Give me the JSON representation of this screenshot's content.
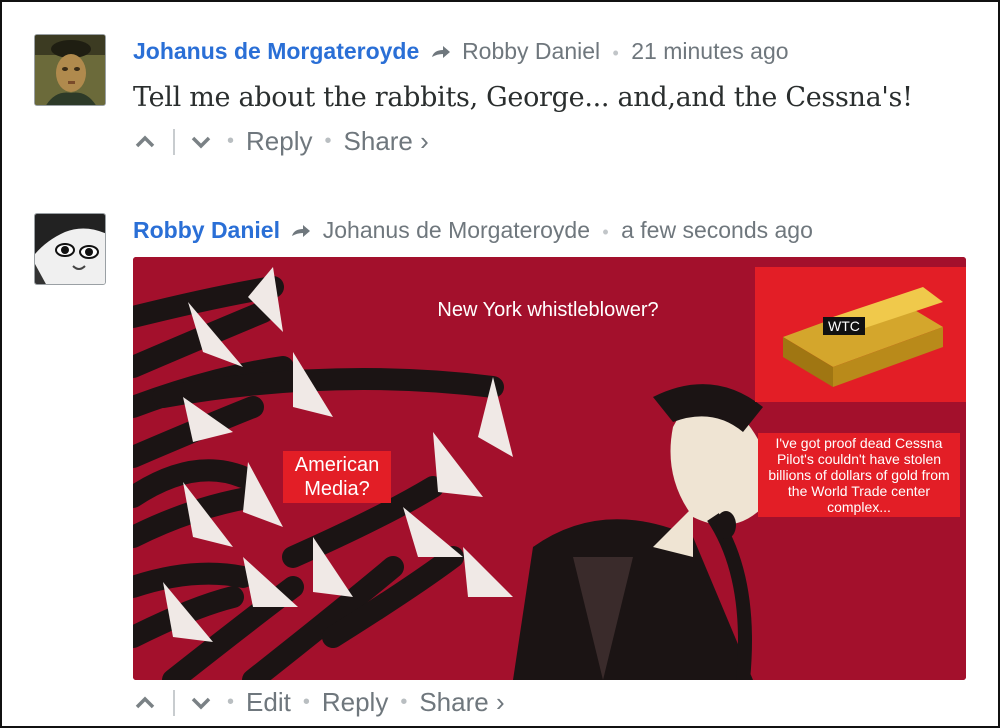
{
  "comments": [
    {
      "author": "Johanus de Morgateroyde",
      "reply_to": "Robby Daniel",
      "time": "21 minutes ago",
      "message": "Tell me about the rabbits, George... and,and the Cessna's!",
      "actions": {
        "reply": "Reply",
        "share": "Share ›"
      }
    },
    {
      "author": "Robby Daniel",
      "reply_to": "Johanus de Morgateroyde",
      "time": "a few seconds ago",
      "image": {
        "headline": "New York whistleblower?",
        "media_label": "American Media?",
        "gold_label": "WTC",
        "proof_text": "I've got proof dead Cessna Pilot's couldn't have stolen billions of dollars of gold from the World Trade center complex..."
      },
      "actions": {
        "edit": "Edit",
        "reply": "Reply",
        "share": "Share ›"
      }
    }
  ],
  "icons": {
    "upvote": "chevron-up-icon",
    "downvote": "chevron-down-icon",
    "reply_arrow": "reply-arrow-icon"
  },
  "colors": {
    "author": "#2a6fd6",
    "image_bg": "#a3102c",
    "label_red": "#e31e26"
  }
}
